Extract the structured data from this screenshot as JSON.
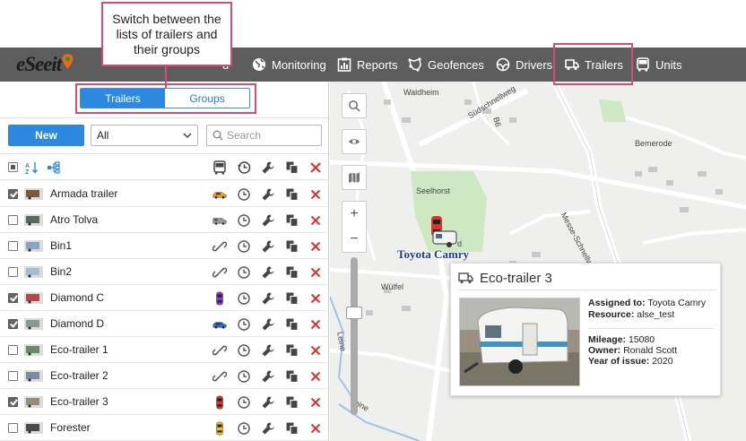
{
  "app": {
    "logo_text": "eSeeit"
  },
  "callout": {
    "text": "Switch between the lists of trailers and their groups"
  },
  "nav": {
    "items": [
      {
        "label": "d",
        "icon": "hidden-icon"
      },
      {
        "label": "Monitoring",
        "icon": "globe-icon"
      },
      {
        "label": "Reports",
        "icon": "report-icon"
      },
      {
        "label": "Geofences",
        "icon": "geofence-icon"
      },
      {
        "label": "Drivers",
        "icon": "steering-wheel-icon"
      },
      {
        "label": "Trailers",
        "icon": "trailer-icon",
        "active": true
      },
      {
        "label": "Units",
        "icon": "bus-icon"
      }
    ]
  },
  "toggle": {
    "trailers": "Trailers",
    "groups": "Groups",
    "active": "Trailers"
  },
  "toolbar": {
    "new_label": "New",
    "filter_value": "All",
    "search_placeholder": "Search"
  },
  "list": {
    "rows": [
      {
        "name": "Armada trailer",
        "checked": true,
        "assigned_icon": "car-orange-icon"
      },
      {
        "name": "Atro Tolva",
        "checked": false,
        "assigned_icon": "van-grey-icon"
      },
      {
        "name": "Bin1",
        "checked": false,
        "assigned_icon": "unlink-icon"
      },
      {
        "name": "Bin2",
        "checked": false,
        "assigned_icon": "unlink-icon"
      },
      {
        "name": "Diamond C",
        "checked": true,
        "assigned_icon": "car-purple-icon"
      },
      {
        "name": "Diamond D",
        "checked": true,
        "assigned_icon": "car-blue-icon"
      },
      {
        "name": "Eco-trailer 1",
        "checked": false,
        "assigned_icon": "unlink-icon"
      },
      {
        "name": "Eco-trailer 2",
        "checked": false,
        "assigned_icon": "unlink-icon"
      },
      {
        "name": "Eco-trailer 3",
        "checked": true,
        "assigned_icon": "car-red-icon"
      },
      {
        "name": "Forester",
        "checked": false,
        "assigned_icon": "car-yellow-icon"
      }
    ]
  },
  "map": {
    "labels": [
      "Waldheim",
      "Südschnellweg",
      "B6",
      "Bemerode",
      "Seelhorst",
      "Wülfel",
      "Leine",
      "Leine",
      "Messe-Schnellweg",
      "d"
    ],
    "vehicle_label": "Toyota Camry"
  },
  "popup": {
    "title": "Eco-trailer 3",
    "assigned_to_label": "Assigned to:",
    "assigned_to_value": "Toyota Camry",
    "resource_label": "Resource:",
    "resource_value": "alse_test",
    "mileage_label": "Mileage:",
    "mileage_value": "15080",
    "owner_label": "Owner:",
    "owner_value": "Ronald Scott",
    "year_label": "Year of issue:",
    "year_value": "2020"
  },
  "colors": {
    "accent": "#2e88e0",
    "callout_border": "#d54b76",
    "nav_bg": "#5d5d5d",
    "delete": "#e03030"
  }
}
